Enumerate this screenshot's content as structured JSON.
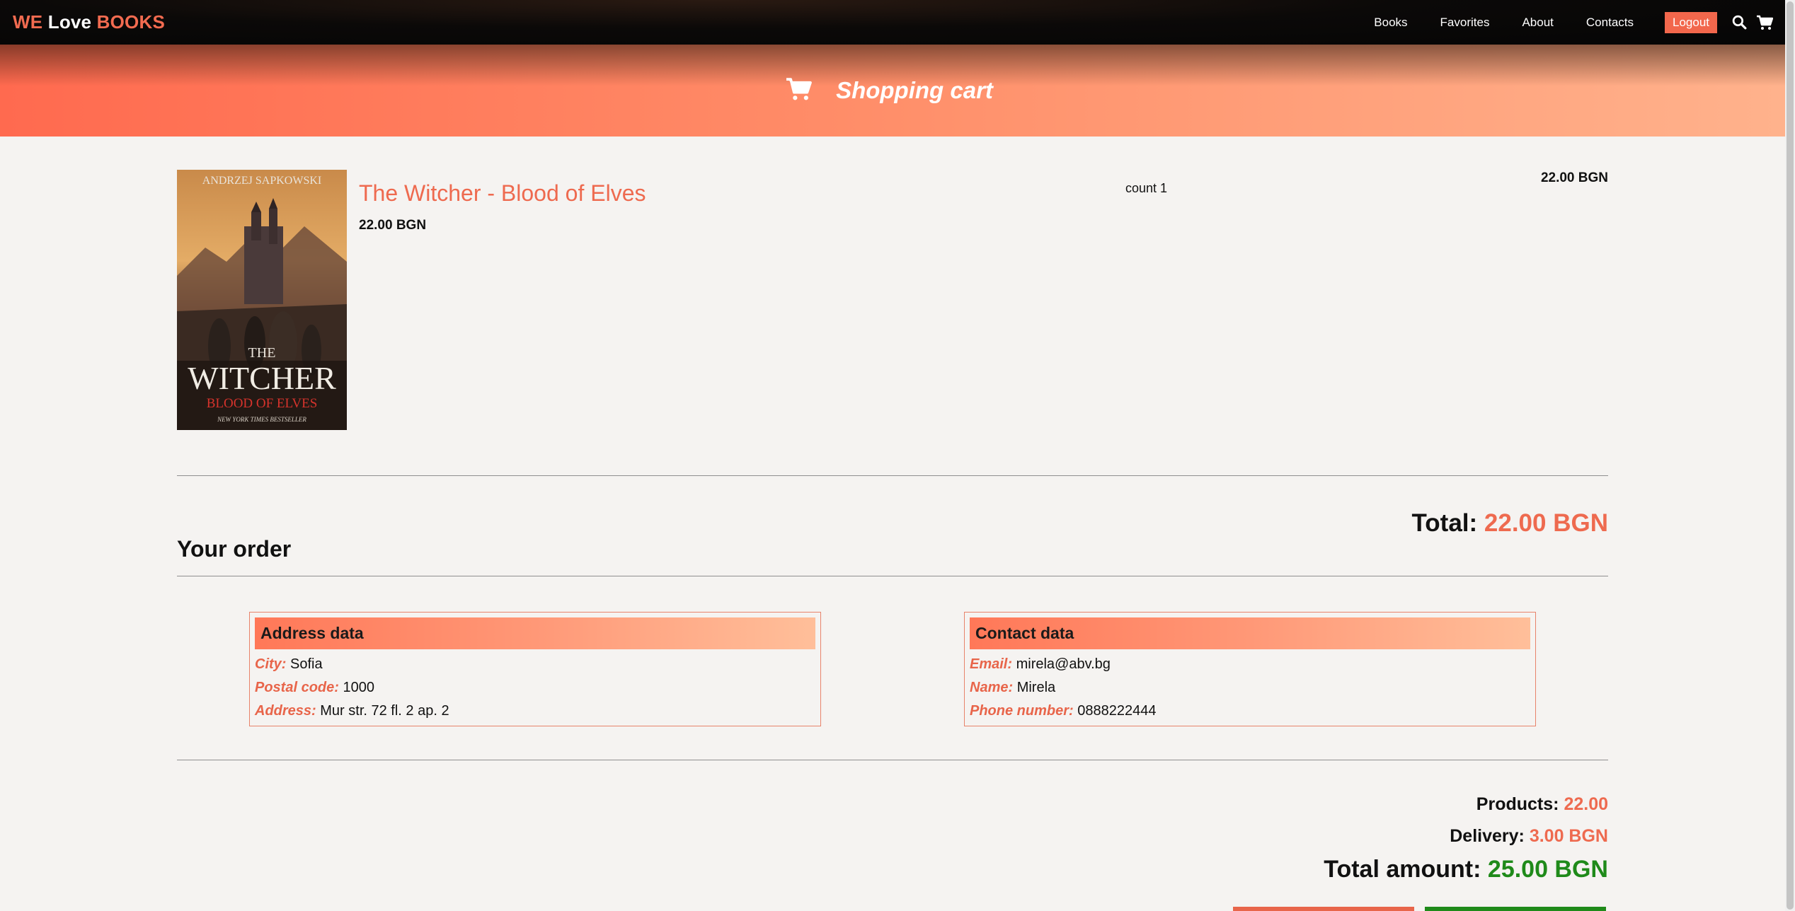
{
  "brand": {
    "we": "WE",
    "love": "Love",
    "books": "BOOKS"
  },
  "nav": {
    "links": [
      "Books",
      "Favorites",
      "About",
      "Contacts"
    ],
    "logout_label": "Logout",
    "icons": [
      "search-icon",
      "cart-icon"
    ]
  },
  "hero": {
    "title": "Shopping cart",
    "icon": "cart-icon"
  },
  "cart": {
    "items": [
      {
        "title": "The Witcher - Blood of Elves",
        "price": "22.00 BGN",
        "count": "count 1",
        "subtotal": "22.00 BGN",
        "cover": {
          "author": "ANDRZEJ SAPKOWSKI",
          "title_the": "THE",
          "title_main": "WITCHER",
          "subtitle": "BLOOD OF ELVES",
          "tagline": "NEW YORK TIMES BESTSELLER"
        }
      }
    ],
    "total_label": "Total:",
    "total_value": "22.00 BGN"
  },
  "order": {
    "heading": "Your order",
    "address": {
      "header": "Address data",
      "city_label": "City:",
      "city": "Sofia",
      "postal_label": "Postal code:",
      "postal": "1000",
      "address_label": "Address:",
      "address": "Mur str. 72 fl. 2 ap. 2"
    },
    "contact": {
      "header": "Contact data",
      "email_label": "Email:",
      "email": "mirela@abv.bg",
      "name_label": "Name:",
      "name": "Mirela",
      "phone_label": "Phone number:",
      "phone": "0888222444"
    }
  },
  "summary": {
    "products_label": "Products:",
    "products_value": "22.00",
    "delivery_label": "Delivery:",
    "delivery_value": "3.00 BGN",
    "total_label": "Total amount:",
    "total_value": "25.00 BGN"
  },
  "colors": {
    "accent": "#ee6a4f",
    "success": "#1f8a1a",
    "nav_bg": "#050505"
  }
}
